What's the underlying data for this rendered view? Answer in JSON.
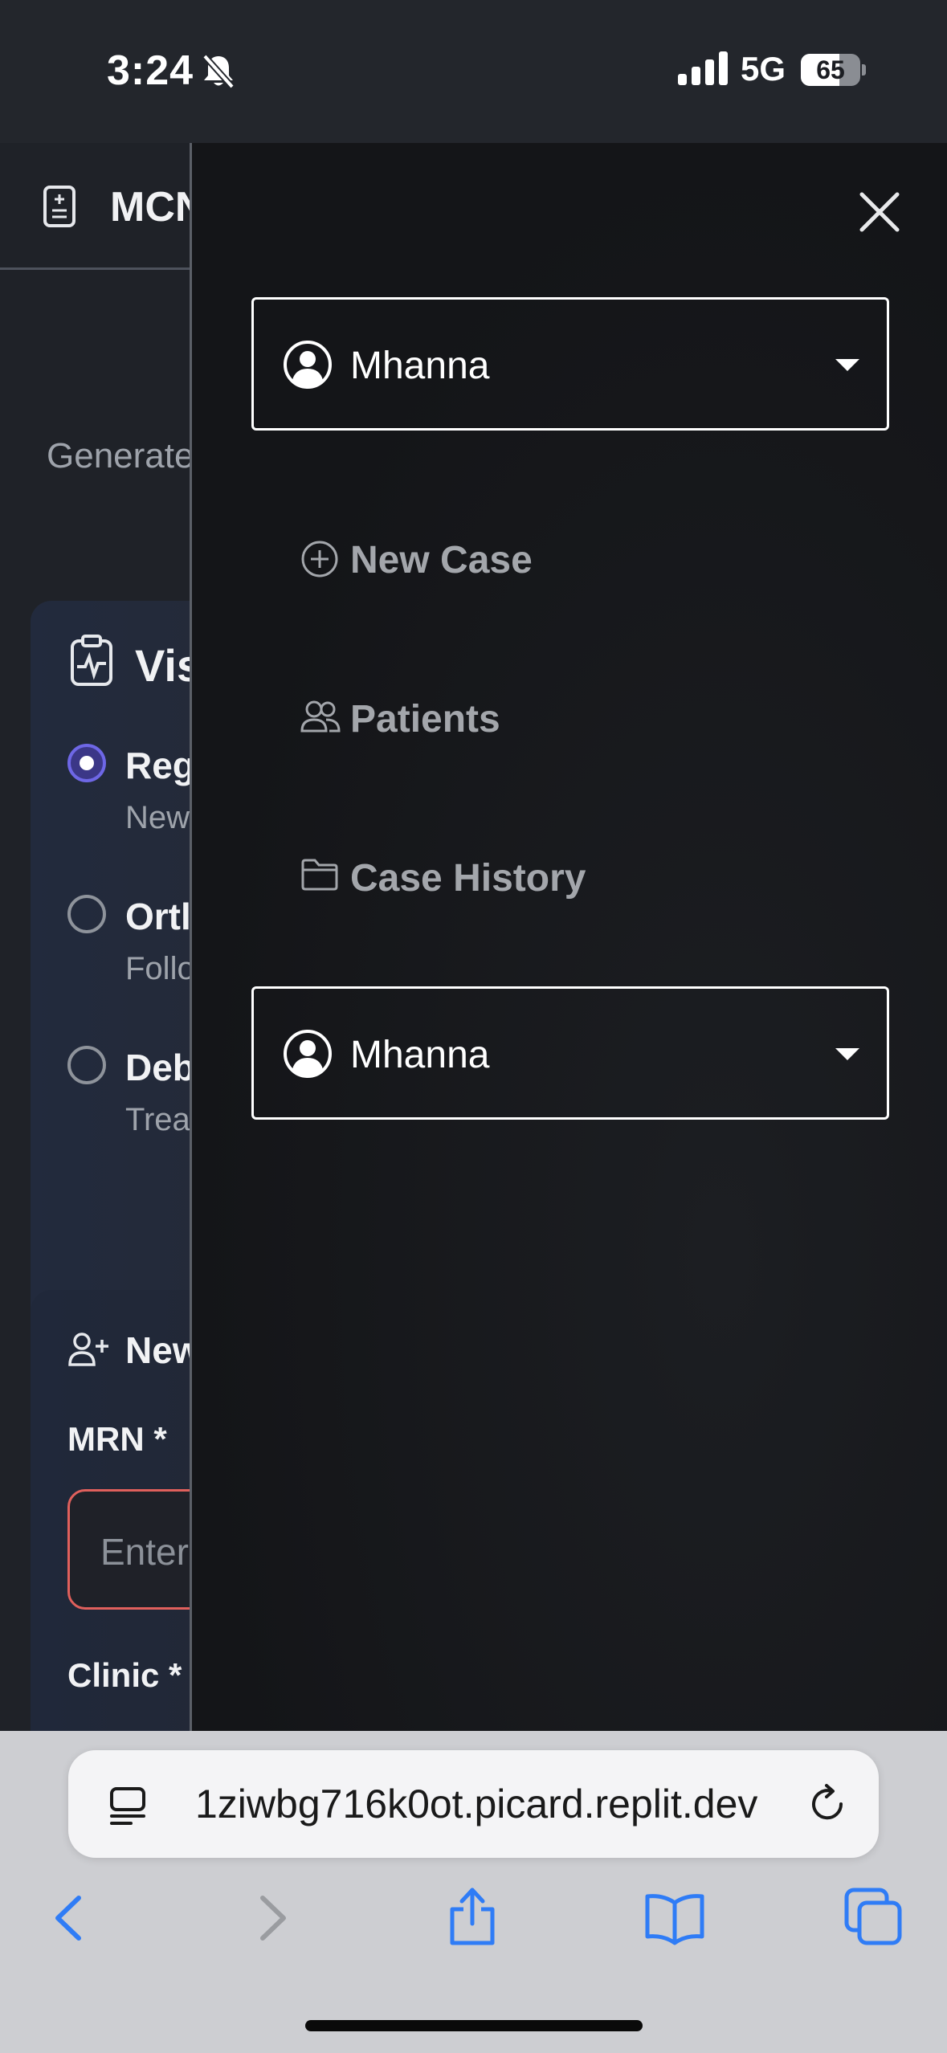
{
  "status": {
    "time": "3:24",
    "network": "5G",
    "battery": "65",
    "battery_level": 0.65
  },
  "background_page": {
    "title": "MCN",
    "subtitle": "Generate",
    "visit_card": {
      "title": "Vis",
      "options": [
        {
          "title": "Reg",
          "subtitle": "New",
          "selected": true
        },
        {
          "title": "Ortl",
          "subtitle": "Follo",
          "selected": false
        },
        {
          "title": "Deb",
          "subtitle": "Trea",
          "selected": false
        }
      ]
    },
    "new_card": {
      "title": "New",
      "mrn_label": "MRN *",
      "mrn_placeholder": "Enter",
      "clinic_label": "Clinic *"
    }
  },
  "drawer": {
    "user_top": "Mhanna",
    "nav": [
      {
        "label": "New Case",
        "icon": "plus-circle-icon"
      },
      {
        "label": "Patients",
        "icon": "users-icon"
      },
      {
        "label": "Case History",
        "icon": "folder-icon"
      }
    ],
    "user_bottom": "Mhanna"
  },
  "browser": {
    "url": "1ziwbg716k0ot.picard.replit.dev"
  },
  "colors": {
    "accent": "#6e67e6",
    "error_border": "#e0605c",
    "safari_blue": "#2f7cf6"
  }
}
